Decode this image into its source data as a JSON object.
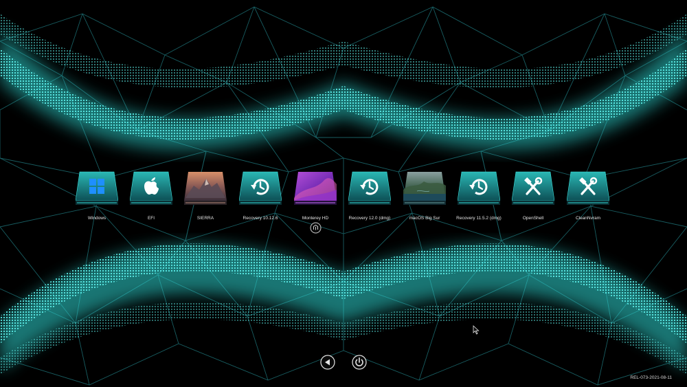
{
  "colors": {
    "accent": "#2fd6d2",
    "mesh": "#1d6e73",
    "background": "#000000",
    "label": "#e8e8e8"
  },
  "entries": [
    {
      "label": "Windows",
      "icon": "windows-logo-icon",
      "selected": false
    },
    {
      "label": "EFI",
      "icon": "apple-logo-icon",
      "selected": false
    },
    {
      "label": "SIERRA",
      "icon": "sierra-mountain-icon",
      "selected": false
    },
    {
      "label": "Recovery 10.12.6",
      "icon": "recovery-clock-icon",
      "selected": false
    },
    {
      "label": "Monterey HD",
      "icon": "monterey-icon",
      "selected": true
    },
    {
      "label": "Recovery 12.0 (dmg)",
      "icon": "recovery-clock-icon",
      "selected": false
    },
    {
      "label": "macOS Big Sur",
      "icon": "big-sur-icon",
      "selected": false
    },
    {
      "label": "Recovery 11.5.2 (dmg)",
      "icon": "recovery-clock-icon",
      "selected": false
    },
    {
      "label": "OpenShell",
      "icon": "tools-icon",
      "selected": false
    },
    {
      "label": "CleanNvram",
      "icon": "tools-icon",
      "selected": false
    }
  ],
  "controls": {
    "back_icon": "back-arrow-icon",
    "power_icon": "power-icon"
  },
  "version": "REL-073-2021-08-11"
}
